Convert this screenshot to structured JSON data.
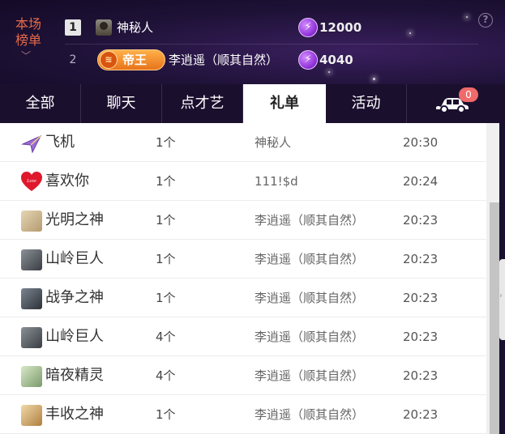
{
  "ranking": {
    "title": "本场榜单",
    "entries": [
      {
        "rank": "1",
        "name": "神秘人",
        "coins": "12000"
      },
      {
        "rank": "2",
        "badge": "帝王",
        "name": "李逍遥（顺其自然）",
        "coins": "4040"
      }
    ]
  },
  "tabs": [
    {
      "label": "全部"
    },
    {
      "label": "聊天"
    },
    {
      "label": "点才艺"
    },
    {
      "label": "礼单",
      "active": true
    },
    {
      "label": "活动"
    }
  ],
  "car": {
    "badge_count": "0"
  },
  "gifts": [
    {
      "name": "飞机",
      "icon": "airplane-icon",
      "count": "1个",
      "sender": "神秘人",
      "time": "20:30"
    },
    {
      "name": "喜欢你",
      "icon": "heart-love-icon",
      "count": "1个",
      "sender": "111!$d",
      "time": "20:24"
    },
    {
      "name": "光明之神",
      "icon": "god-of-light-icon",
      "count": "1个",
      "sender": "李逍遥（顺其自然）",
      "time": "20:23"
    },
    {
      "name": "山岭巨人",
      "icon": "mountain-giant-icon",
      "count": "1个",
      "sender": "李逍遥（顺其自然）",
      "time": "20:23"
    },
    {
      "name": "战争之神",
      "icon": "god-of-war-icon",
      "count": "1个",
      "sender": "李逍遥（顺其自然）",
      "time": "20:23"
    },
    {
      "name": "山岭巨人",
      "icon": "mountain-giant-icon",
      "count": "4个",
      "sender": "李逍遥（顺其自然）",
      "time": "20:23"
    },
    {
      "name": "暗夜精灵",
      "icon": "night-elf-icon",
      "count": "4个",
      "sender": "李逍遥（顺其自然）",
      "time": "20:23"
    },
    {
      "name": "丰收之神",
      "icon": "god-of-harvest-icon",
      "count": "1个",
      "sender": "李逍遥（顺其自然）",
      "time": "20:23"
    }
  ]
}
